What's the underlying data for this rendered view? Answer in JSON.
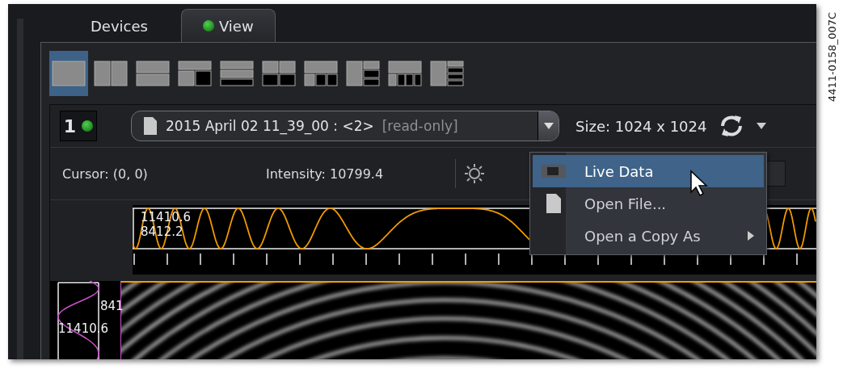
{
  "figure_id": "4411-0158_007C",
  "tabs": [
    {
      "label": "Devices",
      "selected": false,
      "led": false
    },
    {
      "label": "View",
      "selected": true,
      "led": true
    }
  ],
  "layouts": [
    {
      "selected": true
    },
    {
      "selected": false
    },
    {
      "selected": false
    },
    {
      "selected": false
    },
    {
      "selected": false
    },
    {
      "selected": false
    },
    {
      "selected": false
    },
    {
      "selected": false
    },
    {
      "selected": false
    },
    {
      "selected": false
    }
  ],
  "viewer": {
    "number": "1",
    "led_on": true,
    "file": "2015 April 02 11_39_00 : <2>",
    "read_only": "[read-only]",
    "size": "Size: 1024 x 1024"
  },
  "info": {
    "cursor": "Cursor: (0, 0)",
    "intensity": "Intensity: 10799.4"
  },
  "profile": {
    "max": "11410.6",
    "min": "8412.2"
  },
  "side_profile": {
    "value_1": "841",
    "value_2": "11410.6"
  },
  "menu": [
    {
      "label": "Live Data",
      "selected": true,
      "kind": "camera"
    },
    {
      "label": "Open File...",
      "selected": false,
      "kind": "file"
    },
    {
      "label": "Open a Copy As",
      "selected": false,
      "kind": "submenu"
    }
  ]
}
